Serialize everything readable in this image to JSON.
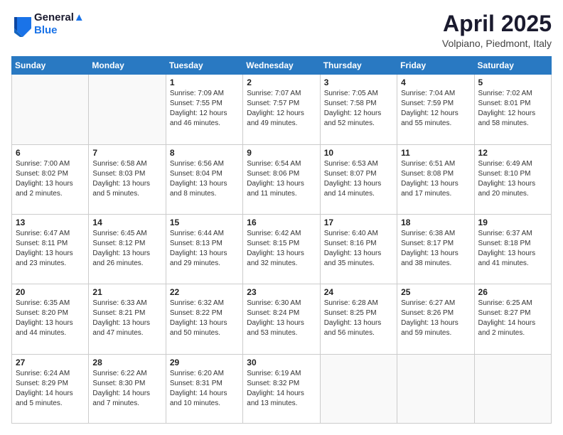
{
  "logo": {
    "line1": "General",
    "line2": "Blue"
  },
  "header": {
    "title": "April 2025",
    "location": "Volpiano, Piedmont, Italy"
  },
  "days_of_week": [
    "Sunday",
    "Monday",
    "Tuesday",
    "Wednesday",
    "Thursday",
    "Friday",
    "Saturday"
  ],
  "weeks": [
    [
      {
        "day": "",
        "info": ""
      },
      {
        "day": "",
        "info": ""
      },
      {
        "day": "1",
        "info": "Sunrise: 7:09 AM\nSunset: 7:55 PM\nDaylight: 12 hours and 46 minutes."
      },
      {
        "day": "2",
        "info": "Sunrise: 7:07 AM\nSunset: 7:57 PM\nDaylight: 12 hours and 49 minutes."
      },
      {
        "day": "3",
        "info": "Sunrise: 7:05 AM\nSunset: 7:58 PM\nDaylight: 12 hours and 52 minutes."
      },
      {
        "day": "4",
        "info": "Sunrise: 7:04 AM\nSunset: 7:59 PM\nDaylight: 12 hours and 55 minutes."
      },
      {
        "day": "5",
        "info": "Sunrise: 7:02 AM\nSunset: 8:01 PM\nDaylight: 12 hours and 58 minutes."
      }
    ],
    [
      {
        "day": "6",
        "info": "Sunrise: 7:00 AM\nSunset: 8:02 PM\nDaylight: 13 hours and 2 minutes."
      },
      {
        "day": "7",
        "info": "Sunrise: 6:58 AM\nSunset: 8:03 PM\nDaylight: 13 hours and 5 minutes."
      },
      {
        "day": "8",
        "info": "Sunrise: 6:56 AM\nSunset: 8:04 PM\nDaylight: 13 hours and 8 minutes."
      },
      {
        "day": "9",
        "info": "Sunrise: 6:54 AM\nSunset: 8:06 PM\nDaylight: 13 hours and 11 minutes."
      },
      {
        "day": "10",
        "info": "Sunrise: 6:53 AM\nSunset: 8:07 PM\nDaylight: 13 hours and 14 minutes."
      },
      {
        "day": "11",
        "info": "Sunrise: 6:51 AM\nSunset: 8:08 PM\nDaylight: 13 hours and 17 minutes."
      },
      {
        "day": "12",
        "info": "Sunrise: 6:49 AM\nSunset: 8:10 PM\nDaylight: 13 hours and 20 minutes."
      }
    ],
    [
      {
        "day": "13",
        "info": "Sunrise: 6:47 AM\nSunset: 8:11 PM\nDaylight: 13 hours and 23 minutes."
      },
      {
        "day": "14",
        "info": "Sunrise: 6:45 AM\nSunset: 8:12 PM\nDaylight: 13 hours and 26 minutes."
      },
      {
        "day": "15",
        "info": "Sunrise: 6:44 AM\nSunset: 8:13 PM\nDaylight: 13 hours and 29 minutes."
      },
      {
        "day": "16",
        "info": "Sunrise: 6:42 AM\nSunset: 8:15 PM\nDaylight: 13 hours and 32 minutes."
      },
      {
        "day": "17",
        "info": "Sunrise: 6:40 AM\nSunset: 8:16 PM\nDaylight: 13 hours and 35 minutes."
      },
      {
        "day": "18",
        "info": "Sunrise: 6:38 AM\nSunset: 8:17 PM\nDaylight: 13 hours and 38 minutes."
      },
      {
        "day": "19",
        "info": "Sunrise: 6:37 AM\nSunset: 8:18 PM\nDaylight: 13 hours and 41 minutes."
      }
    ],
    [
      {
        "day": "20",
        "info": "Sunrise: 6:35 AM\nSunset: 8:20 PM\nDaylight: 13 hours and 44 minutes."
      },
      {
        "day": "21",
        "info": "Sunrise: 6:33 AM\nSunset: 8:21 PM\nDaylight: 13 hours and 47 minutes."
      },
      {
        "day": "22",
        "info": "Sunrise: 6:32 AM\nSunset: 8:22 PM\nDaylight: 13 hours and 50 minutes."
      },
      {
        "day": "23",
        "info": "Sunrise: 6:30 AM\nSunset: 8:24 PM\nDaylight: 13 hours and 53 minutes."
      },
      {
        "day": "24",
        "info": "Sunrise: 6:28 AM\nSunset: 8:25 PM\nDaylight: 13 hours and 56 minutes."
      },
      {
        "day": "25",
        "info": "Sunrise: 6:27 AM\nSunset: 8:26 PM\nDaylight: 13 hours and 59 minutes."
      },
      {
        "day": "26",
        "info": "Sunrise: 6:25 AM\nSunset: 8:27 PM\nDaylight: 14 hours and 2 minutes."
      }
    ],
    [
      {
        "day": "27",
        "info": "Sunrise: 6:24 AM\nSunset: 8:29 PM\nDaylight: 14 hours and 5 minutes."
      },
      {
        "day": "28",
        "info": "Sunrise: 6:22 AM\nSunset: 8:30 PM\nDaylight: 14 hours and 7 minutes."
      },
      {
        "day": "29",
        "info": "Sunrise: 6:20 AM\nSunset: 8:31 PM\nDaylight: 14 hours and 10 minutes."
      },
      {
        "day": "30",
        "info": "Sunrise: 6:19 AM\nSunset: 8:32 PM\nDaylight: 14 hours and 13 minutes."
      },
      {
        "day": "",
        "info": ""
      },
      {
        "day": "",
        "info": ""
      },
      {
        "day": "",
        "info": ""
      }
    ]
  ]
}
